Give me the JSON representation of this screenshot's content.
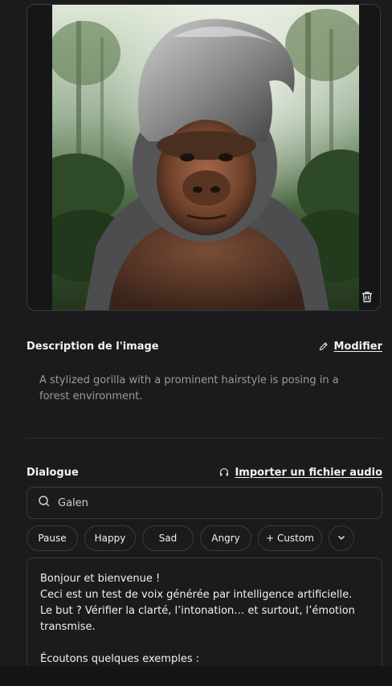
{
  "image_card": {
    "trash_icon": "trash-icon",
    "image_subject": "gorilla-portrait"
  },
  "description": {
    "title": "Description de l'image",
    "edit_label": "Modifier",
    "edit_icon": "pencil-icon",
    "text": "A stylized gorilla with a prominent hairstyle is posing in a forest environment."
  },
  "dialogue": {
    "title": "Dialogue",
    "import_label": "Importer un fichier audio",
    "import_icon": "headphones-icon",
    "search": {
      "value": "Galen",
      "icon": "search-icon"
    },
    "chips": [
      "Pause",
      "Happy",
      "Sad",
      "Angry",
      "+ Custom"
    ],
    "more_icon": "chevron-down-icon",
    "text_lines": [
      "Bonjour et bienvenue !",
      "Ceci est un test de voix générée par intelligence artificielle.",
      "Le but ? Vérifier la clarté, l’intonation… et surtout, l’émotion",
      "transmise.",
      "",
      "Écoutons quelques exemples :"
    ]
  },
  "colors": {
    "background": "#1b1b1d",
    "border": "#3b3b3f",
    "text": "#f1f1f1",
    "muted_text": "#9a9a9f"
  }
}
